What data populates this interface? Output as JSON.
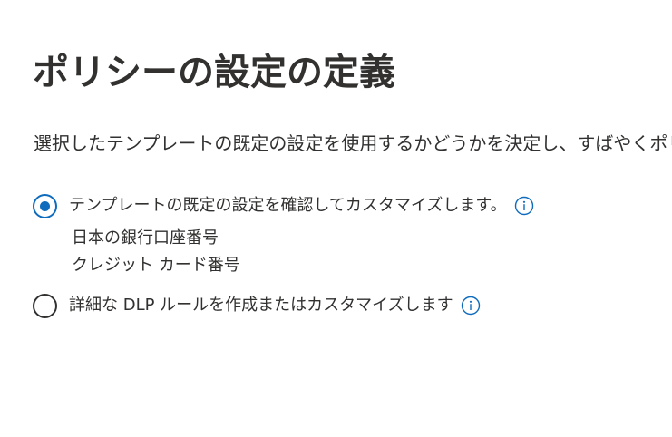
{
  "page": {
    "title": "ポリシーの設定の定義",
    "description": "選択したテンプレートの既定の設定を使用するかどうかを決定し、すばやくポリ"
  },
  "options": [
    {
      "label": "テンプレートの既定の設定を確認してカスタマイズします。",
      "selected": true,
      "info_icon": "info-icon",
      "details": [
        "日本の銀行口座番号",
        "クレジット カード番号"
      ]
    },
    {
      "label": "詳細な DLP ルールを作成またはカスタマイズします",
      "selected": false,
      "info_icon": "info-icon"
    }
  ],
  "colors": {
    "accent": "#0f6cbd",
    "text": "#323130",
    "background": "#ffffff"
  }
}
